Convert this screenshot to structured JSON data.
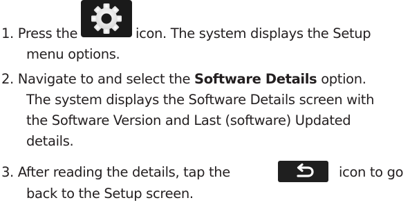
{
  "steps": [
    {
      "number": "1.",
      "before_icon": "Press the",
      "icon": "gear-icon",
      "after_icon": "icon. The system displays the Setup",
      "line2": "menu options."
    },
    {
      "number": "2.",
      "line1_before": "Navigate to and select the",
      "line1_bold": "Software Details",
      "line1_after": "option.",
      "line2": "The system displays the Software Details screen with",
      "line3": "the Software Version and Last (software) Updated",
      "line4": "details."
    },
    {
      "number": "3.",
      "before_icon": "After reading the details, tap the",
      "icon": "back-arrow-icon",
      "after_icon": "icon to go",
      "line2": "back to the Setup screen."
    }
  ],
  "colors": {
    "text": "#231f20",
    "icon_tile": "#1a1a1a",
    "icon_glyph": "#ffffff"
  }
}
